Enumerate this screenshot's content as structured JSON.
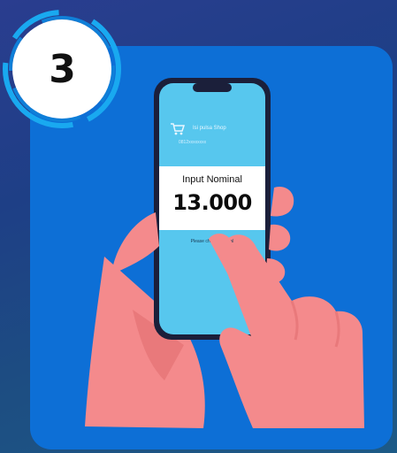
{
  "step": {
    "number": "3"
  },
  "phone": {
    "brand_name": "Isi pulsa Shop",
    "brand_subtitle": "0812xxxxxxxx",
    "input_label": "Input Nominal",
    "input_value": "13.000",
    "hint": "Please check nominal"
  },
  "colors": {
    "card": "#0d6fd6",
    "badge_ring": "#19a9f0",
    "phone_screen": "#57c7ee",
    "skin": "#f48a8c",
    "phone_frame": "#1b1f3a"
  },
  "icons": {
    "brand": "shopping-cart-icon"
  }
}
